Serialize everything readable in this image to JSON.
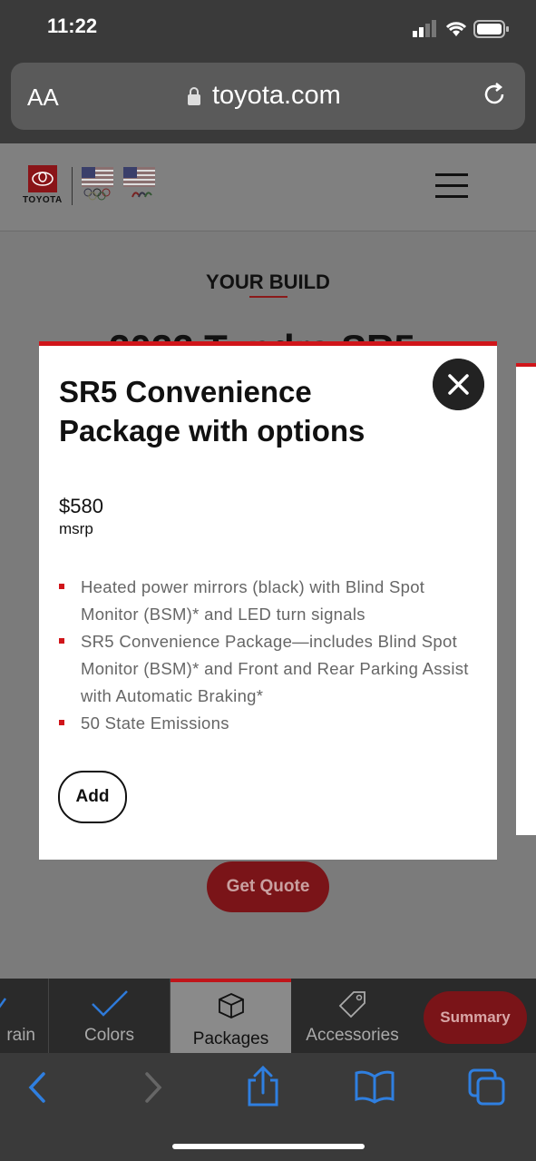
{
  "status_bar": {
    "time": "11:22"
  },
  "browser": {
    "text_size_label": "AA",
    "url": "toyota.com"
  },
  "site": {
    "brand_word": "TOYOTA"
  },
  "build": {
    "heading": "YOUR BUILD",
    "model_title": "2022 Tundra SR5"
  },
  "modal": {
    "title": "SR5 Convenience Package with options",
    "price": "$580",
    "price_label": "msrp",
    "features": [
      "Heated power mirrors (black) with Blind Spot Monitor (BSM)* and LED turn signals",
      "SR5 Convenience Package—includes Blind Spot Monitor (BSM)* and Front and Rear Parking Assist with Automatic Braking*",
      "50 State Emissions"
    ],
    "add_label": "Add"
  },
  "quote_button": "Get Quote",
  "tabs": [
    {
      "label": "rain"
    },
    {
      "label": "Colors"
    },
    {
      "label": "Packages"
    },
    {
      "label": "Accessories"
    }
  ],
  "summary_button": "Summary",
  "colors": {
    "accent_red": "#d0151a",
    "dark_red": "#7a1418"
  }
}
